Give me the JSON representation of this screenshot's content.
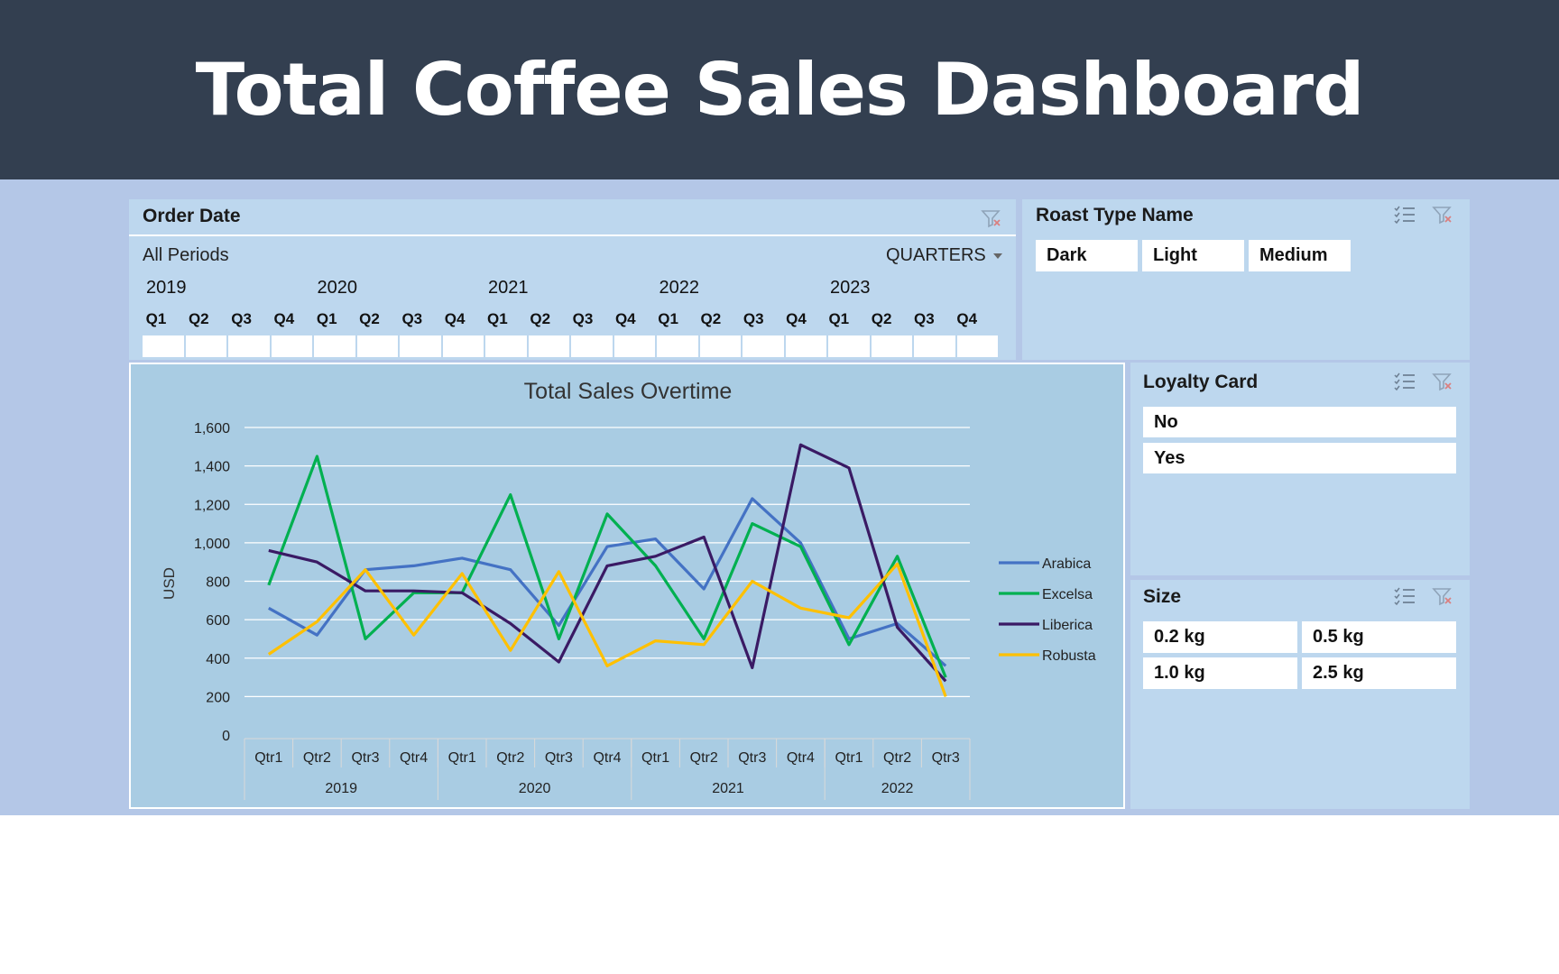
{
  "title": "Total Coffee Sales Dashboard",
  "order_date": {
    "header": "Order Date",
    "all_periods": "All Periods",
    "period_select": "QUARTERS",
    "years": [
      "2019",
      "2020",
      "2021",
      "2022",
      "2023"
    ],
    "quarters": [
      "Q1",
      "Q2",
      "Q3",
      "Q4",
      "Q1",
      "Q2",
      "Q3",
      "Q4",
      "Q1",
      "Q2",
      "Q3",
      "Q4",
      "Q1",
      "Q2",
      "Q3",
      "Q4",
      "Q1",
      "Q2",
      "Q3",
      "Q4"
    ]
  },
  "roast_type": {
    "header": "Roast Type Name",
    "items": [
      "Dark",
      "Light",
      "Medium"
    ]
  },
  "loyalty_card": {
    "header": "Loyalty Card",
    "items": [
      "No",
      "Yes"
    ]
  },
  "size": {
    "header": "Size",
    "items": [
      "0.2 kg",
      "0.5 kg",
      "1.0 kg",
      "2.5 kg"
    ]
  },
  "icons": {
    "multi_select": "multi-select-icon",
    "clear_filter": "clear-filter-icon",
    "dropdown": "dropdown-arrow-icon"
  },
  "chart_data": {
    "type": "line",
    "title": "Total Sales Overtime",
    "ylabel": "USD",
    "xlabel": "",
    "ylim": [
      0,
      1600
    ],
    "yticks": [
      "0",
      "200",
      "400",
      "600",
      "800",
      "1,000",
      "1,200",
      "1,400",
      "1,600"
    ],
    "categories": [
      "Qtr1",
      "Qtr2",
      "Qtr3",
      "Qtr4",
      "Qtr1",
      "Qtr2",
      "Qtr3",
      "Qtr4",
      "Qtr1",
      "Qtr2",
      "Qtr3",
      "Qtr4",
      "Qtr1",
      "Qtr2",
      "Qtr3"
    ],
    "year_groups": [
      {
        "label": "2019",
        "count": 4
      },
      {
        "label": "2020",
        "count": 4
      },
      {
        "label": "2021",
        "count": 4
      },
      {
        "label": "2022",
        "count": 3
      }
    ],
    "grid": true,
    "legend_position": "right",
    "series": [
      {
        "name": "Arabica",
        "color": "#4472c4",
        "values": [
          660,
          520,
          860,
          880,
          920,
          860,
          570,
          980,
          1020,
          760,
          1230,
          1000,
          500,
          580,
          360
        ]
      },
      {
        "name": "Excelsa",
        "color": "#00b050",
        "values": [
          780,
          1450,
          500,
          740,
          740,
          1250,
          500,
          1150,
          880,
          500,
          1100,
          980,
          470,
          930,
          300
        ]
      },
      {
        "name": "Liberica",
        "color": "#3a1a64",
        "values": [
          960,
          900,
          750,
          750,
          740,
          580,
          380,
          880,
          930,
          1030,
          350,
          1510,
          1390,
          560,
          280
        ]
      },
      {
        "name": "Robusta",
        "color": "#ffc000",
        "values": [
          420,
          590,
          860,
          520,
          840,
          440,
          850,
          360,
          490,
          470,
          800,
          660,
          610,
          890,
          200
        ]
      }
    ]
  }
}
